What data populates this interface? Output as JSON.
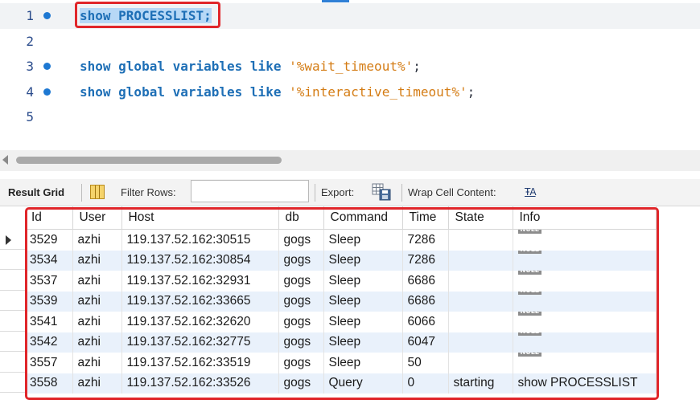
{
  "editor": {
    "lines": [
      {
        "num": "1",
        "has_dot": true,
        "current": true,
        "tokens": [
          {
            "t": "show PROCESSLIST",
            "k": "sel"
          },
          {
            "t": ";",
            "k": "sel-punc"
          }
        ]
      },
      {
        "num": "2",
        "has_dot": false,
        "current": false,
        "tokens": []
      },
      {
        "num": "3",
        "has_dot": true,
        "current": false,
        "tokens": [
          {
            "t": "show global variables like ",
            "k": "kw"
          },
          {
            "t": "'%wait_timeout%'",
            "k": "str"
          },
          {
            "t": ";",
            "k": "punc"
          }
        ]
      },
      {
        "num": "4",
        "has_dot": true,
        "current": false,
        "tokens": [
          {
            "t": "show global variables like ",
            "k": "kw"
          },
          {
            "t": "'%interactive_timeout%'",
            "k": "str"
          },
          {
            "t": ";",
            "k": "punc"
          }
        ]
      },
      {
        "num": "5",
        "has_dot": false,
        "current": false,
        "tokens": []
      }
    ]
  },
  "toolbar": {
    "result_grid_label": "Result Grid",
    "filter_rows_label": "Filter Rows:",
    "filter_value": "",
    "export_label": "Export:",
    "wrap_label": "Wrap Cell Content:",
    "wrap_icon_glyph": "ŦA"
  },
  "grid": {
    "columns": [
      "Id",
      "User",
      "Host",
      "db",
      "Command",
      "Time",
      "State",
      "Info"
    ],
    "selected_row": 0,
    "null_label": "NULL",
    "rows": [
      [
        "3529",
        "azhi",
        "119.137.52.162:30515",
        "gogs",
        "Sleep",
        "7286",
        "",
        null
      ],
      [
        "3534",
        "azhi",
        "119.137.52.162:30854",
        "gogs",
        "Sleep",
        "7286",
        "",
        null
      ],
      [
        "3537",
        "azhi",
        "119.137.52.162:32931",
        "gogs",
        "Sleep",
        "6686",
        "",
        null
      ],
      [
        "3539",
        "azhi",
        "119.137.52.162:33665",
        "gogs",
        "Sleep",
        "6686",
        "",
        null
      ],
      [
        "3541",
        "azhi",
        "119.137.52.162:32620",
        "gogs",
        "Sleep",
        "6066",
        "",
        null
      ],
      [
        "3542",
        "azhi",
        "119.137.52.162:32775",
        "gogs",
        "Sleep",
        "6047",
        "",
        null
      ],
      [
        "3557",
        "azhi",
        "119.137.52.162:33519",
        "gogs",
        "Sleep",
        "50",
        "",
        null
      ],
      [
        "3558",
        "azhi",
        "119.137.52.162:33526",
        "gogs",
        "Query",
        "0",
        "starting",
        "show PROCESSLIST"
      ]
    ]
  },
  "colors": {
    "keyword": "#1e6fb6",
    "string": "#d47c14",
    "selection": "#b7d8f6",
    "highlight_box": "#e0262a",
    "alt_row": "#e9f1fb"
  }
}
